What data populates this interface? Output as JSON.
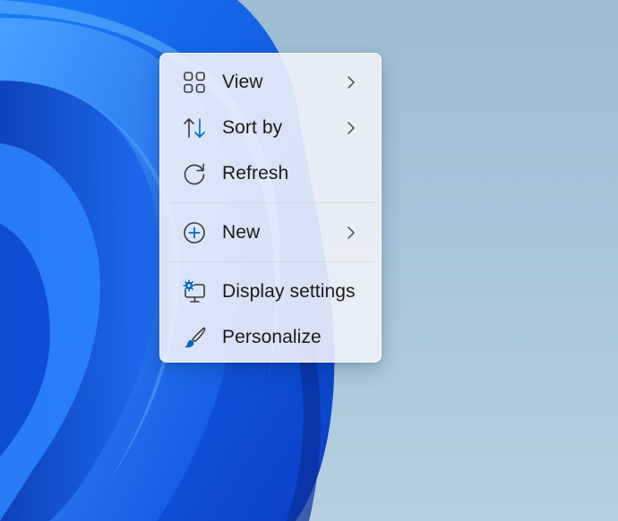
{
  "context_menu": {
    "items": [
      {
        "label": "View",
        "icon": "view-grid-icon",
        "has_submenu": true
      },
      {
        "label": "Sort by",
        "icon": "sort-arrows-icon",
        "has_submenu": true
      },
      {
        "label": "Refresh",
        "icon": "refresh-icon",
        "has_submenu": false
      },
      {
        "label": "New",
        "icon": "new-plus-circle-icon",
        "has_submenu": true
      },
      {
        "label": "Display settings",
        "icon": "display-settings-icon",
        "has_submenu": false
      },
      {
        "label": "Personalize",
        "icon": "personalize-brush-icon",
        "has_submenu": false
      }
    ]
  },
  "colors": {
    "accent": "#0067c0",
    "text": "#1b1b1b",
    "menu_background": "#eef2fa",
    "wallpaper_bloom": "#0f5bea"
  }
}
